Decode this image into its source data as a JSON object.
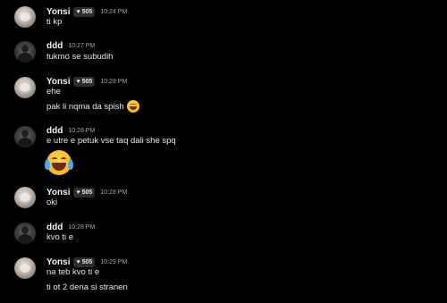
{
  "colors": {
    "background": "#000000",
    "username": "#f2f3f5",
    "message_text": "#e6e7e9",
    "timestamp": "#a3a6aa",
    "badge_bg": "#2b2d31"
  },
  "messages": [
    {
      "author": "Yonsi",
      "badge": "505",
      "time": "10:24 PM",
      "lines": [
        "ti kp"
      ]
    },
    {
      "author": "ddd",
      "time": "10:27 PM",
      "lines": [
        "tukmo  se subudih"
      ]
    },
    {
      "author": "Yonsi",
      "badge": "505",
      "time": "10:28 PM",
      "lines": [
        "ehe",
        "pak li nqma da spish"
      ],
      "emoji": "grinning-squinting-face"
    },
    {
      "author": "ddd",
      "time": "10:28 PM",
      "lines": [
        "e utre e petuk vse taq dali she spq"
      ],
      "emoji": "face-with-tears-of-joy"
    },
    {
      "author": "Yonsi",
      "badge": "505",
      "time": "10:28 PM",
      "lines": [
        "oki"
      ]
    },
    {
      "author": "ddd",
      "time": "10:28 PM",
      "lines": [
        "kvo ti e"
      ]
    },
    {
      "author": "Yonsi",
      "badge": "505",
      "time": "10:29 PM",
      "lines": [
        "na teb kvo ti e",
        "ti ot 2 dena si stranen"
      ]
    }
  ]
}
